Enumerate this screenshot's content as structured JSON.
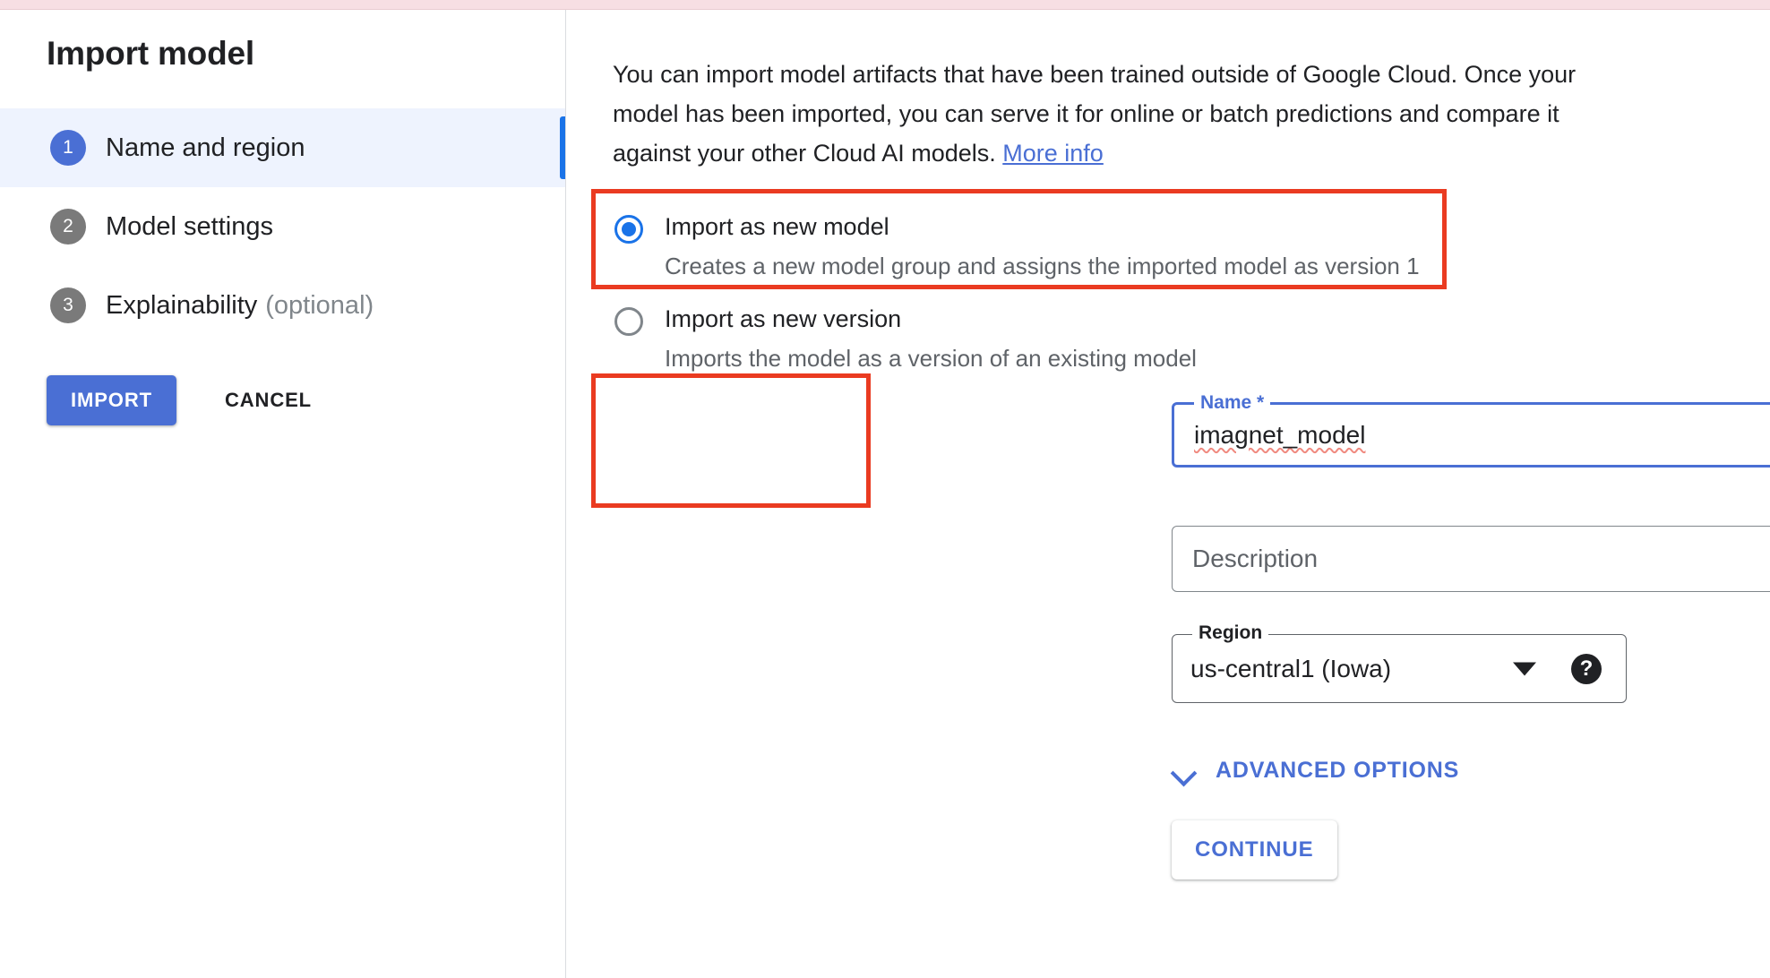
{
  "window": {
    "title": "Import model"
  },
  "sidebar": {
    "title": "Import model",
    "steps": [
      {
        "number": "1",
        "label": "Name and region",
        "optional": "",
        "active": true
      },
      {
        "number": "2",
        "label": "Model settings",
        "optional": "",
        "active": false
      },
      {
        "number": "3",
        "label": "Explainability",
        "optional": "(optional)",
        "active": false
      }
    ],
    "actions": {
      "import_label": "IMPORT",
      "cancel_label": "CANCEL"
    }
  },
  "main": {
    "intro": {
      "text": "You can import model artifacts that have been trained outside of Google Cloud. Once your model has been imported, you can serve it for online or batch predictions and compare it against your other Cloud AI models.",
      "link_label": "More info"
    },
    "import_mode": {
      "options": [
        {
          "title": "Import as new model",
          "subtitle": "Creates a new model group and assigns the imported model as version 1",
          "selected": true
        },
        {
          "title": "Import as new version",
          "subtitle": "Imports the model as a version of an existing model",
          "selected": false
        }
      ]
    },
    "name_field": {
      "label": "Name *",
      "value": "imagnet_model"
    },
    "description_field": {
      "placeholder": "Description",
      "value": ""
    },
    "region_field": {
      "label": "Region",
      "value": "us-central1 (Iowa)",
      "help_icon": "help-icon",
      "dropdown_icon": "chevron-down-icon"
    },
    "advanced_options": {
      "label": "ADVANCED OPTIONS",
      "icon": "chevron-down-icon"
    },
    "continue_button": {
      "label": "CONTINUE"
    }
  },
  "annotations": {
    "colors": {
      "highlight": "#ea3b21",
      "accent_blue": "#4a6fd4",
      "link_blue": "#1a73e8",
      "top_band": "#f7dfe3",
      "active_step_bg": "#eef3fe",
      "muted_text": "#5f6368"
    }
  }
}
